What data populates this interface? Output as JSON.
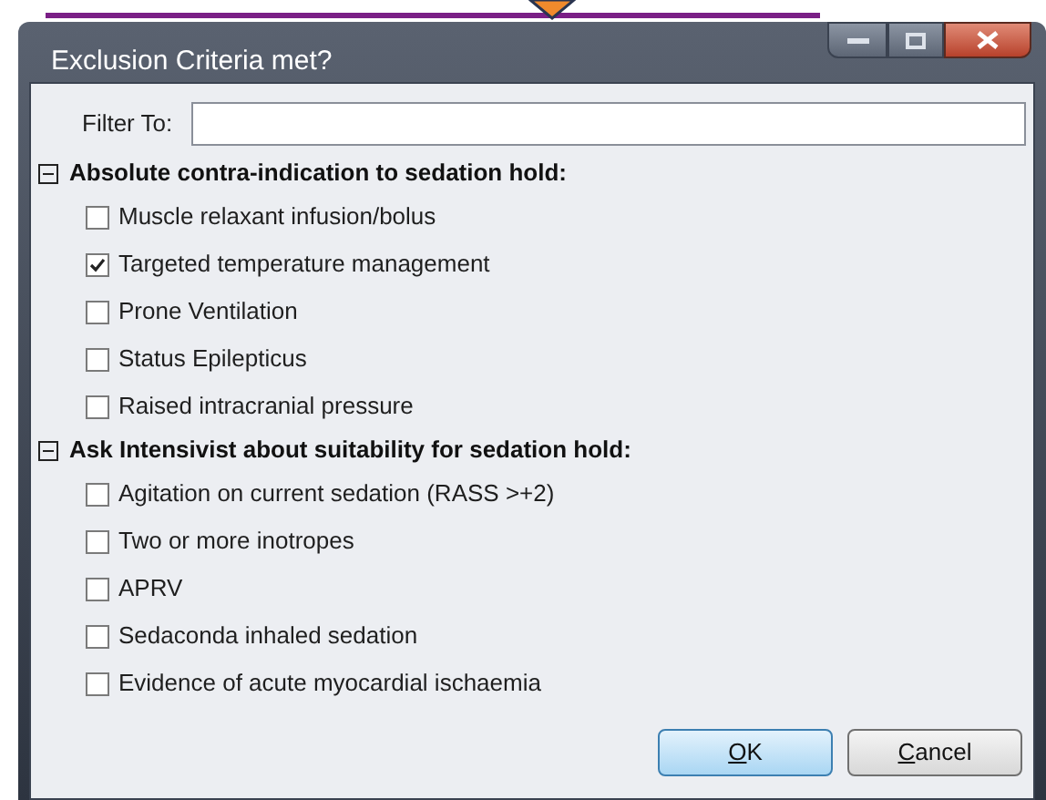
{
  "window": {
    "title": "Exclusion Criteria met?"
  },
  "filter": {
    "label": "Filter To:"
  },
  "groups": [
    {
      "title": "Absolute contra-indication to sedation hold:",
      "expanded": true,
      "items": [
        {
          "label": "Muscle relaxant infusion/bolus",
          "checked": false
        },
        {
          "label": "Targeted temperature management",
          "checked": true
        },
        {
          "label": "Prone Ventilation",
          "checked": false
        },
        {
          "label": "Status Epilepticus",
          "checked": false
        },
        {
          "label": "Raised intracranial pressure",
          "checked": false
        }
      ]
    },
    {
      "title": "Ask Intensivist about suitability for sedation hold:",
      "expanded": true,
      "items": [
        {
          "label": "Agitation on current sedation (RASS >+2)",
          "checked": false
        },
        {
          "label": "Two or more inotropes",
          "checked": false
        },
        {
          "label": "APRV",
          "checked": false
        },
        {
          "label": "Sedaconda inhaled sedation",
          "checked": false
        },
        {
          "label": "Evidence of acute myocardial ischaemia",
          "checked": false
        }
      ]
    }
  ],
  "buttons": [
    {
      "label": "OK",
      "kind": "default"
    },
    {
      "label": "Cancel",
      "kind": "normal"
    }
  ]
}
